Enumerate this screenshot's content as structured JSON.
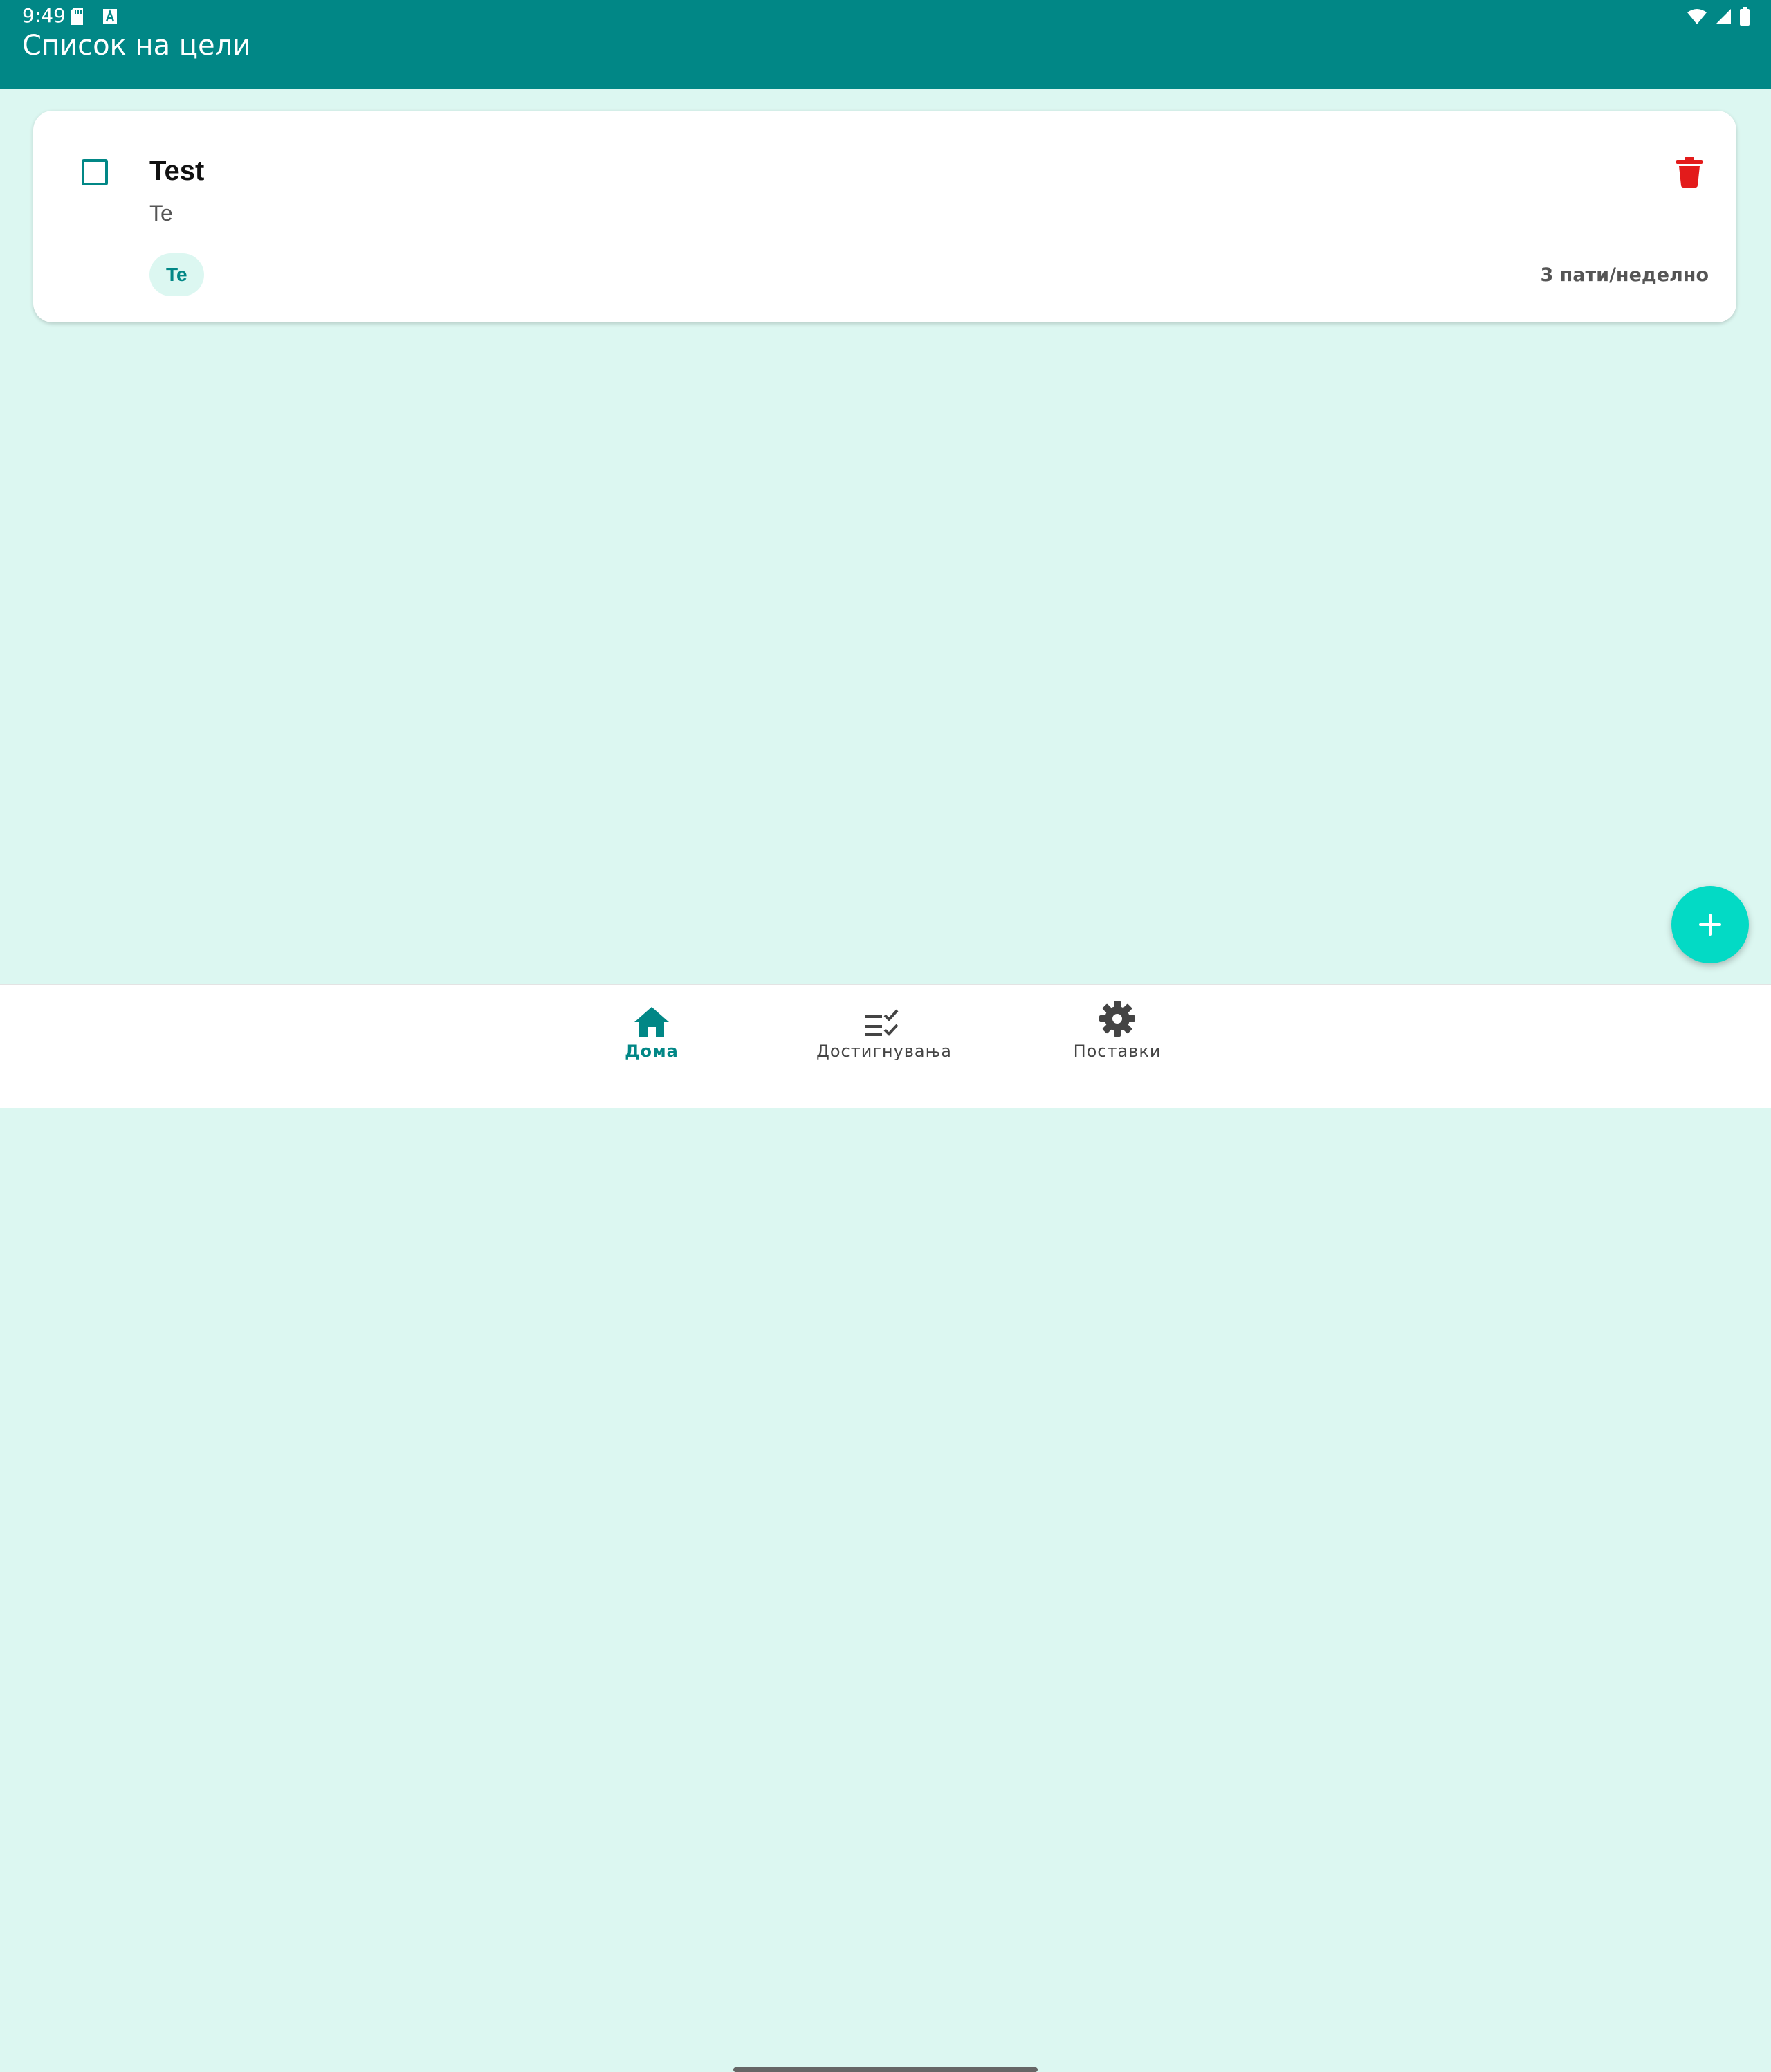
{
  "status_bar": {
    "time": "9:49"
  },
  "app_bar": {
    "title": "Список на цели"
  },
  "goals": [
    {
      "title": "Test",
      "description": "Te",
      "tag": "Te",
      "frequency": "3 пати/неделно",
      "checked": false
    }
  ],
  "bottom_nav": {
    "items": [
      {
        "label": "Дома",
        "icon": "home-icon",
        "active": true
      },
      {
        "label": "Достигнувања",
        "icon": "checklist-icon",
        "active": false
      },
      {
        "label": "Поставки",
        "icon": "gear-icon",
        "active": false
      }
    ]
  },
  "fab": {
    "icon": "plus-icon"
  },
  "colors": {
    "primary": "#018786",
    "secondary": "#03dac5",
    "background": "#dcf7f1",
    "delete": "#e31b1b"
  }
}
